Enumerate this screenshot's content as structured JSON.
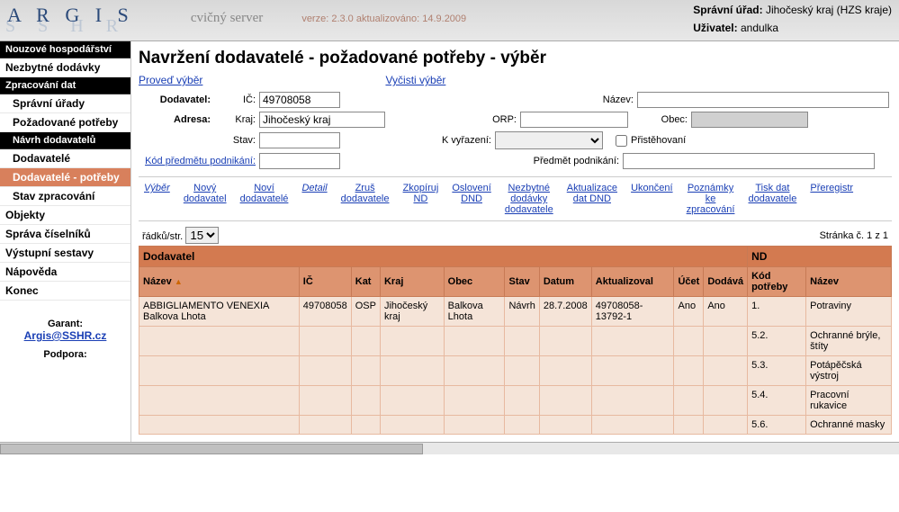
{
  "header": {
    "logo": "A R G I S",
    "logo_back": "S S H R",
    "server": "cvičný server",
    "version": "verze: 2.3.0 aktualizováno: 14.9.2009",
    "admin_label": "Správní úřad:",
    "admin_value": "Jihočeský kraj (HZS kraje)",
    "user_label": "Uživatel:",
    "user_value": "andulka"
  },
  "sidebar": {
    "nouzove": "Nouzové hospodářství",
    "nezbytne": "Nezbytné dodávky",
    "zprac_dat": "Zpracování dat",
    "spravni": "Správní úřady",
    "pozad": "Požadované potřeby",
    "navrh": "Návrh dodavatelů",
    "dodavatele": "Dodavatelé",
    "dod_potreby": "Dodavatelé - potřeby",
    "stav": "Stav zpracování",
    "objekty": "Objekty",
    "sprava": "Správa číselníků",
    "vystup": "Výstupní sestavy",
    "napoveda": "Nápověda",
    "konec": "Konec",
    "garant_label": "Garant:",
    "garant_email": "Argis@SSHR.cz",
    "podpora": "Podpora:"
  },
  "page": {
    "title": "Navržení dodavatelé - požadované potřeby - výběr",
    "proved": "Proveď výběr",
    "vycisti": "Vyčisti výběr"
  },
  "filter": {
    "dodavatel": "Dodavatel:",
    "ic": "IČ:",
    "ic_val": "49708058",
    "nazev": "Název:",
    "adresa": "Adresa:",
    "kraj_l": "Kraj:",
    "kraj_v": "Jihočeský kraj",
    "orp": "ORP:",
    "obec": "Obec:",
    "stav": "Stav:",
    "kvyr": "K vyřazení:",
    "prist": "Přistěhovaní",
    "kod_pred": "Kód předmětu podnikání:",
    "predmet": "Předmět podnikání:"
  },
  "actions": {
    "vyber": "Výběr",
    "novy1": "Nový",
    "novy2": "dodavatel",
    "novi1": "Noví",
    "novi2": "dodavatelé",
    "detail": "Detail",
    "zrus1": "Zruš",
    "zrus2": "dodavatele",
    "zkop1": "Zkopíruj",
    "zkop2": "ND",
    "osl1": "Oslovení",
    "osl2": "DND",
    "nezb1": "Nezbytné",
    "nezb2": "dodávky",
    "nezb3": "dodavatele",
    "akt1": "Aktualizace",
    "akt2": "dat DND",
    "ukon": "Ukončení",
    "pozn1": "Poznámky",
    "pozn2": "ke",
    "pozn3": "zpracování",
    "tisk1": "Tisk dat",
    "tisk2": "dodavatele",
    "prer": "Přeregistr"
  },
  "pagebar": {
    "rows": "řádků/str.",
    "rows_val": "15",
    "page": "Stránka č. 1 z 1"
  },
  "thead": {
    "group_dod": "Dodavatel",
    "group_nd": "ND",
    "nazev": "Název",
    "ic": "IČ",
    "kat": "Kat",
    "kraj": "Kraj",
    "obec": "Obec",
    "stav": "Stav",
    "datum": "Datum",
    "akt": "Aktualizoval",
    "ucet": "Účet",
    "dodava": "Dodává",
    "kod": "Kód potřeby",
    "nd_nazev": "Název"
  },
  "rows": [
    {
      "nazev": "ABBIGLIAMENTO VENEXIA Balkova Lhota",
      "ic": "49708058",
      "kat": "OSP",
      "kraj": "Jihočeský kraj",
      "obec": "Balkova Lhota",
      "stav": "Návrh",
      "datum": "28.7.2008",
      "akt": "49708058-13792-1",
      "ucet": "Ano",
      "dodava": "Ano",
      "kod": "1.",
      "ndnazev": "Potraviny"
    },
    {
      "kod": "5.2.",
      "ndnazev": "Ochranné brýle, štíty"
    },
    {
      "kod": "5.3.",
      "ndnazev": "Potápěčská výstroj"
    },
    {
      "kod": "5.4.",
      "ndnazev": "Pracovní rukavice"
    },
    {
      "kod": "5.6.",
      "ndnazev": "Ochranné masky"
    }
  ]
}
